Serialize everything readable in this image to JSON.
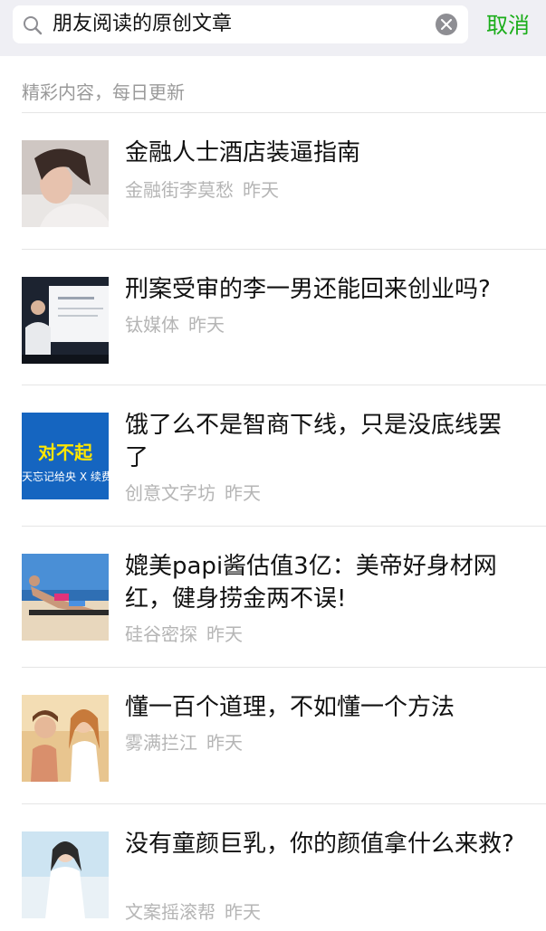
{
  "search": {
    "query": "朋友阅读的原创文章",
    "cancel_label": "取消"
  },
  "section": {
    "header": "精彩内容，每日更新"
  },
  "articles": [
    {
      "title": "金融人士酒店装逼指南",
      "source": "金融街李莫愁",
      "time": "昨天",
      "thumb": "woman-lying-photo"
    },
    {
      "title": "刑案受审的李一男还能回来创业吗?",
      "source": "钛媒体",
      "time": "昨天",
      "thumb": "stage-speaker-photo"
    },
    {
      "title": "饿了么不是智商下线，只是没底线罢了",
      "source": "创意文字坊",
      "time": "昨天",
      "thumb": "blue-apology-banner",
      "thumb_text": "对不起",
      "thumb_subtext": "天忘记给央 X 续费"
    },
    {
      "title": "媲美papi酱估值3亿：美帝好身材网红，健身捞金两不误!",
      "source": "硅谷密探",
      "time": "昨天",
      "thumb": "beach-pushup-photo"
    },
    {
      "title": "懂一百个道理，不如懂一个方法",
      "source": "雾满拦江",
      "time": "昨天",
      "thumb": "two-children-photo"
    },
    {
      "title": "没有童颜巨乳，你的颜值拿什么来救?",
      "source": "文案摇滚帮",
      "time": "昨天",
      "thumb": "woman-white-dress-photo"
    }
  ],
  "colors": {
    "accent": "#1aad19",
    "search_bar_bg": "#efeff4",
    "meta_text": "#b5b5b5"
  }
}
